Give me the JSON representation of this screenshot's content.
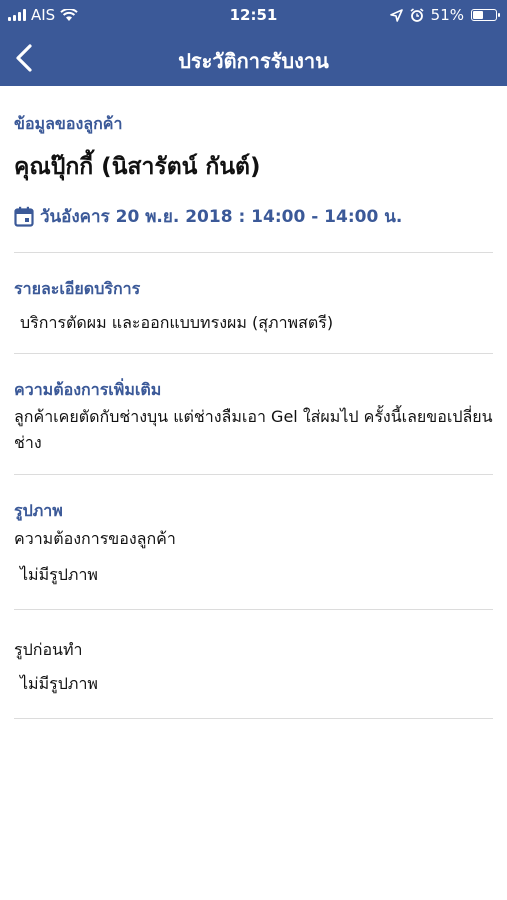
{
  "status_bar": {
    "carrier": "AIS",
    "time": "12:51",
    "battery": "51%",
    "battery_level": 0.51
  },
  "navbar": {
    "title": "ประวัติการรับงาน",
    "back_icon": "chevron-left-icon"
  },
  "customer": {
    "section_label": "ข้อมูลของลูกค้า",
    "name": "คุณปุ๊กกี้ (นิสารัตน์ กันต์)",
    "appointment": "วันอังคาร 20 พ.ย. 2018 : 14:00 - 14:00 น.",
    "calendar_icon": "calendar-icon"
  },
  "service": {
    "label": "รายละเอียดบริการ",
    "value": "บริการตัดผม และออกแบบทรงผม (สุภาพสตรี)"
  },
  "extra": {
    "label": "ความต้องการเพิ่มเติม",
    "value": "ลูกค้าเคยตัดกับช่างบุน แต่ช่างลืมเอา Gel ใส่ผมไป ครั้งนี้เลยขอเปลี่ยนช่าง"
  },
  "photos": {
    "label": "รูปภาพ",
    "customer_needs": {
      "label": "ความต้องการของลูกค้า",
      "value": "ไม่มีรูปภาพ"
    },
    "before": {
      "label": "รูปก่อนทำ",
      "value": "ไม่มีรูปภาพ"
    }
  },
  "colors": {
    "primary": "#3b5998",
    "divider": "#dcdcdc",
    "text": "#111111"
  }
}
